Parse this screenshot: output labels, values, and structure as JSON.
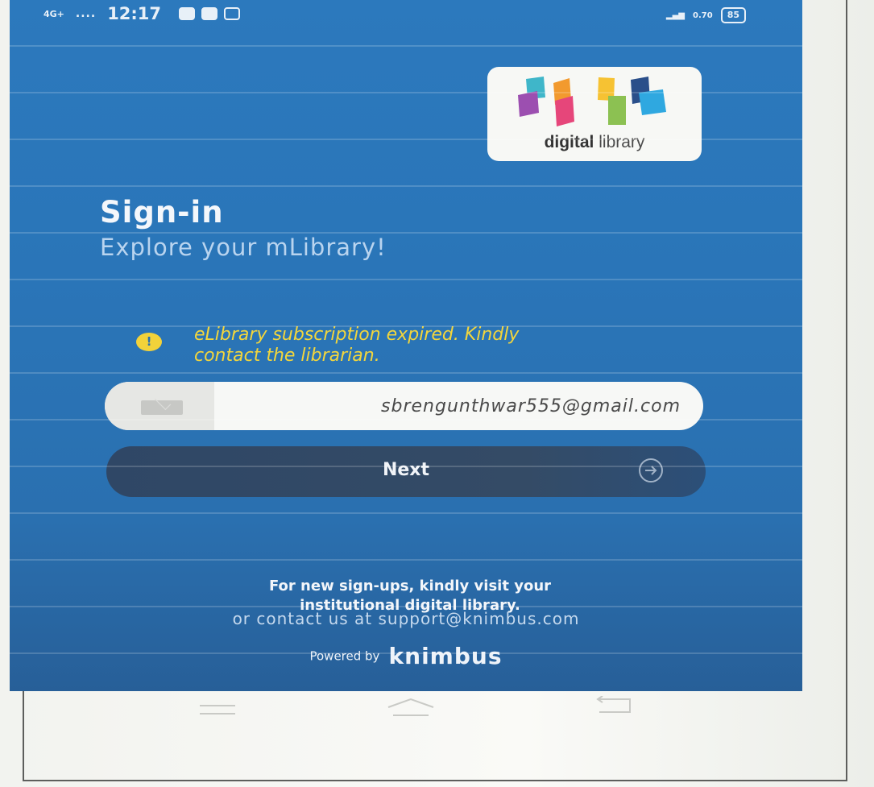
{
  "status_bar": {
    "network": "4G+",
    "time": "12:17",
    "speed": "0.70",
    "battery": "85"
  },
  "logo": {
    "word_bold": "digital",
    "word_regular": "library"
  },
  "signin": {
    "title": "Sign-in",
    "subtitle": "Explore your mLibrary!"
  },
  "warning": {
    "icon_glyph": "!",
    "line1": "eLibrary subscription expired. Kindly",
    "line2": "contact the librarian."
  },
  "email": {
    "value": "sbrengunthwar555@gmail.com"
  },
  "next_button": {
    "label": "Next"
  },
  "footer": {
    "line1": "For new sign-ups, kindly visit your",
    "line2": "institutional digital library.",
    "contact": "or contact us at support@knimbus.com",
    "powered_by": "Powered by",
    "brand": "knimbus"
  },
  "colors": {
    "background_blue": "#2a75b8",
    "warning_yellow": "#f3d63c",
    "button_dark": "#344b66"
  },
  "icons": [
    "mail-icon",
    "arrow-circle-right-icon",
    "warning-icon",
    "menu-icon",
    "home-icon",
    "back-icon"
  ]
}
